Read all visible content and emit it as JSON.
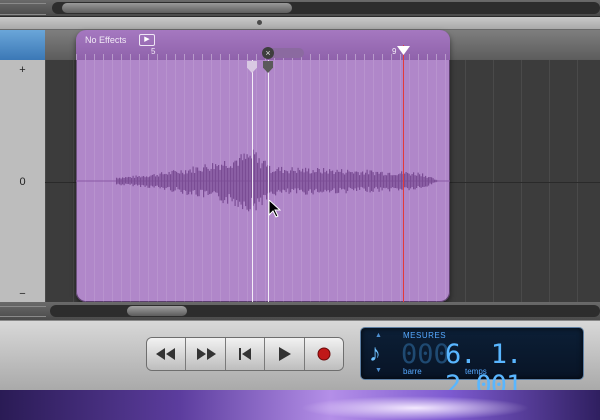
{
  "region": {
    "effects_label": "No Effects",
    "ruler_marks": [
      "5",
      "9"
    ],
    "close_loop_glyph": "×"
  },
  "gutter": {
    "plus": "+",
    "zero": "0",
    "minus": "−"
  },
  "transport": {
    "buttons": [
      {
        "name": "rewind-icon",
        "glyph": "◀◀"
      },
      {
        "name": "fast-forward-icon",
        "glyph": "▶▶"
      },
      {
        "name": "go-to-start-icon",
        "glyph": "|◀"
      },
      {
        "name": "play-icon",
        "glyph": "▶"
      },
      {
        "name": "record-icon",
        "glyph": "●"
      }
    ]
  },
  "lcd": {
    "mode": "MESURES",
    "ghost_digits": "000",
    "position": "6. 1. 2.001",
    "bar_label": "barre",
    "beat_label": "temps",
    "note_glyph": "♪",
    "up_glyph": "▲",
    "down_glyph": "▼"
  },
  "colors": {
    "region_fill": "#b087c9",
    "waveform": "#7a4c94",
    "playhead": "#e33a3a",
    "lcd_text": "#59b6ff",
    "record": "#c01818"
  }
}
